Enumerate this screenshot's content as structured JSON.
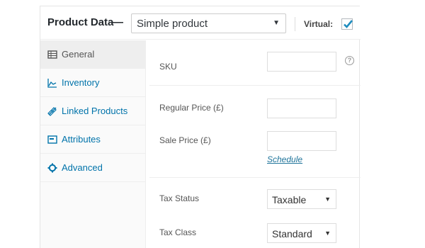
{
  "header": {
    "title": "Product Data",
    "dash": "—",
    "product_type": "Simple product",
    "virtual_label": "Virtual:",
    "virtual_checked": true
  },
  "tabs": [
    {
      "label": "General",
      "icon": "table-icon",
      "active": true
    },
    {
      "label": "Inventory",
      "icon": "chart-icon",
      "active": false
    },
    {
      "label": "Linked Products",
      "icon": "link-icon",
      "active": false
    },
    {
      "label": "Attributes",
      "icon": "attributes-icon",
      "active": false
    },
    {
      "label": "Advanced",
      "icon": "gear-icon",
      "active": false
    }
  ],
  "general": {
    "sku_label": "SKU",
    "sku_value": "",
    "help_glyph": "?",
    "regular_price_label": "Regular Price (£)",
    "regular_price_value": "",
    "sale_price_label": "Sale Price (£)",
    "sale_price_value": "",
    "schedule_link": "Schedule",
    "tax_status_label": "Tax Status",
    "tax_status_value": "Taxable",
    "tax_class_label": "Tax Class",
    "tax_class_value": "Standard"
  },
  "colors": {
    "link": "#0073aa",
    "checkmark": "#1e8cbe",
    "active_tab_bg": "#eeeeee"
  }
}
